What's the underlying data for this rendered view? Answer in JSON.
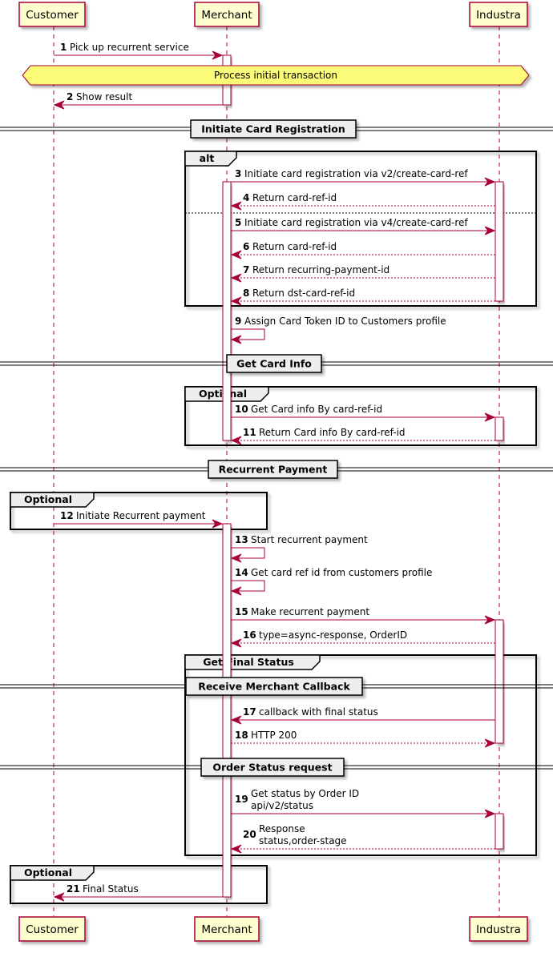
{
  "colors": {
    "arrow": "#A80036",
    "participant_fill": "#FEFECE",
    "divider_fill": "#FBFB77",
    "group_fill": "#EEEEEE",
    "frame": "#000000"
  },
  "participants": [
    "Customer",
    "Merchant",
    "Industra"
  ],
  "messages": [
    {
      "num": "1",
      "text": [
        "Pick up recurrent service"
      ],
      "from": 0,
      "to": 1,
      "dashed": false
    },
    {
      "num": "2",
      "text": [
        "Show result"
      ],
      "from": 1,
      "to": 0,
      "dashed": false
    },
    {
      "num": "3",
      "text": [
        "Initiate card registration via v2/create-card-ref"
      ],
      "from": 1,
      "to": 2,
      "dashed": false
    },
    {
      "num": "4",
      "text": [
        "Return card-ref-id"
      ],
      "from": 2,
      "to": 1,
      "dashed": true
    },
    {
      "num": "5",
      "text": [
        "Initiate card registration via v4/create-card-ref"
      ],
      "from": 1,
      "to": 2,
      "dashed": false
    },
    {
      "num": "6",
      "text": [
        "Return card-ref-id"
      ],
      "from": 2,
      "to": 1,
      "dashed": true
    },
    {
      "num": "7",
      "text": [
        "Return recurring-payment-id"
      ],
      "from": 2,
      "to": 1,
      "dashed": true
    },
    {
      "num": "8",
      "text": [
        "Return dst-card-ref-id"
      ],
      "from": 2,
      "to": 1,
      "dashed": true
    },
    {
      "num": "9",
      "text": [
        "Assign Card Token ID to Customers profile"
      ],
      "from": 1,
      "to": 1,
      "dashed": false
    },
    {
      "num": "10",
      "text": [
        "Get Card info By card-ref-id"
      ],
      "from": 1,
      "to": 2,
      "dashed": false
    },
    {
      "num": "11",
      "text": [
        "Return Card info By card-ref-id"
      ],
      "from": 2,
      "to": 1,
      "dashed": true
    },
    {
      "num": "12",
      "text": [
        "Initiate Recurrent payment"
      ],
      "from": 0,
      "to": 1,
      "dashed": false
    },
    {
      "num": "13",
      "text": [
        "Start recurrent payment"
      ],
      "from": 1,
      "to": 1,
      "dashed": false
    },
    {
      "num": "14",
      "text": [
        "Get card ref id from customers profile"
      ],
      "from": 1,
      "to": 1,
      "dashed": false
    },
    {
      "num": "15",
      "text": [
        "Make recurrent payment"
      ],
      "from": 1,
      "to": 2,
      "dashed": false
    },
    {
      "num": "16",
      "text": [
        "type=async-response, OrderID"
      ],
      "from": 2,
      "to": 1,
      "dashed": true
    },
    {
      "num": "17",
      "text": [
        "callback with final status"
      ],
      "from": 2,
      "to": 1,
      "dashed": false
    },
    {
      "num": "18",
      "text": [
        "HTTP 200"
      ],
      "from": 1,
      "to": 2,
      "dashed": true
    },
    {
      "num": "19",
      "text": [
        "Get status by Order ID",
        "api/v2/status"
      ],
      "from": 1,
      "to": 2,
      "dashed": false
    },
    {
      "num": "20",
      "text": [
        "Response",
        "status,order-stage"
      ],
      "from": 2,
      "to": 1,
      "dashed": true
    },
    {
      "num": "21",
      "text": [
        "Final Status"
      ],
      "from": 1,
      "to": 0,
      "dashed": false
    }
  ],
  "hex_divider": "Process initial transaction",
  "separators": [
    "Initiate Card Registration",
    "Get Card Info",
    "Recurrent Payment",
    "Receive Merchant Callback",
    "Order Status request"
  ],
  "groups": [
    "alt",
    "Optional",
    "Optional",
    "Get Final Status",
    "Optional"
  ]
}
